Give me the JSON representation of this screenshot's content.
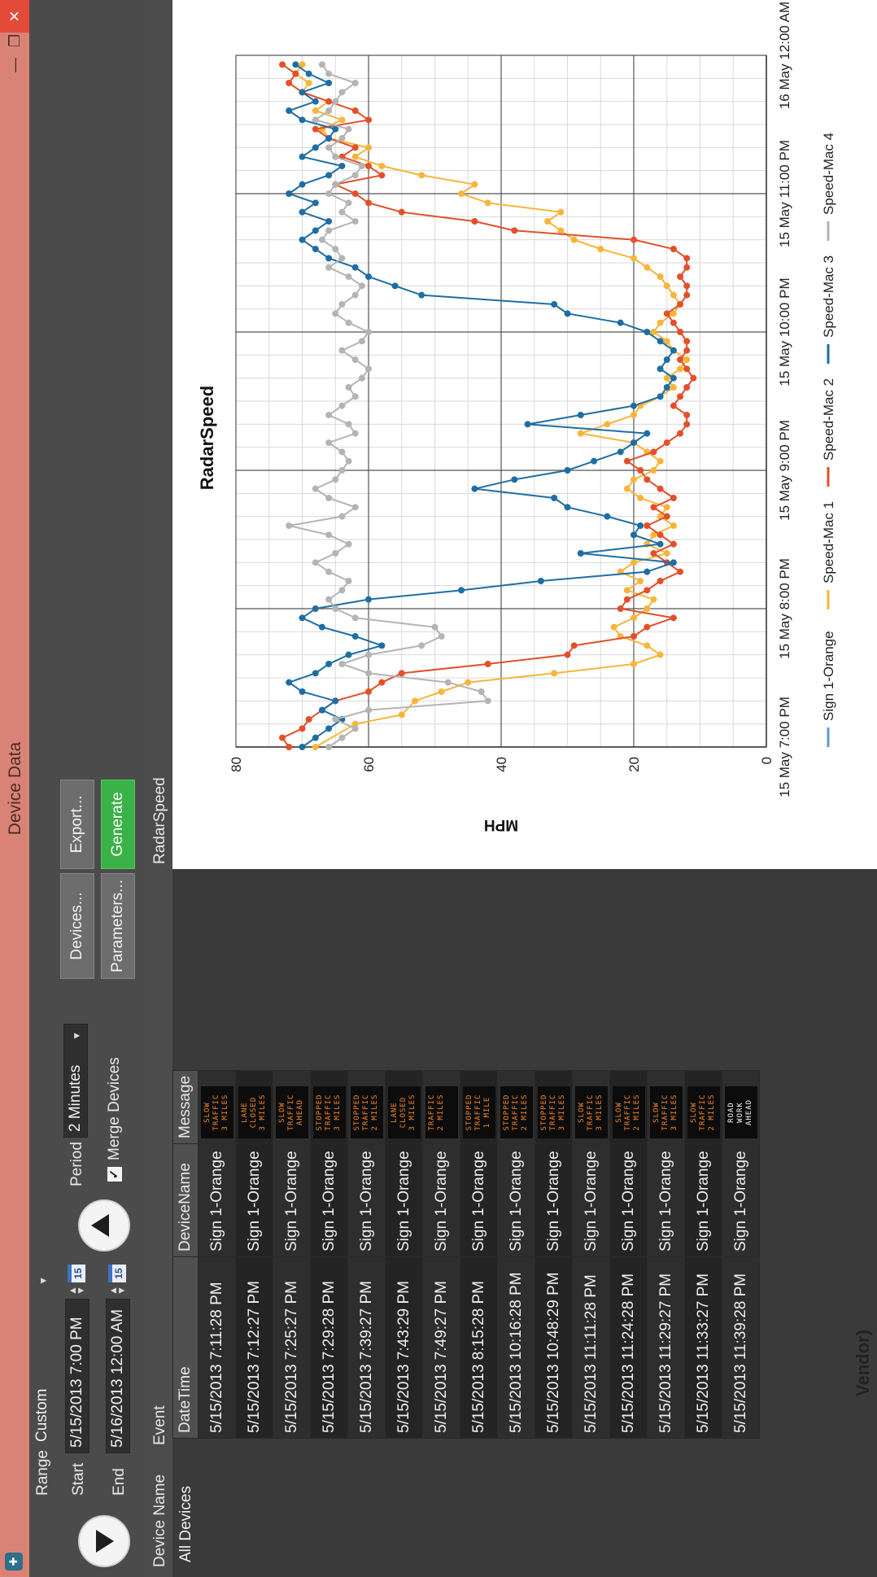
{
  "window": {
    "title": "Device Data",
    "vendor_tag": "Vendor)"
  },
  "toolbar": {
    "range_label": "Range",
    "range_value": "Custom",
    "start_label": "Start",
    "start_value": "5/15/2013 7:00 PM",
    "end_label": "End",
    "end_value": "5/16/2013 12:00 AM",
    "calendar_day": "15",
    "period_label": "Period",
    "period_value": "2 Minutes",
    "merge_label": "Merge Devices",
    "merge_checked": true,
    "devices_label": "Devices...",
    "parameters_label": "Parameters...",
    "export_label": "Export...",
    "generate_label": "Generate"
  },
  "device_panel": {
    "header": "Device Name",
    "items": [
      "All Devices"
    ]
  },
  "event_panel": {
    "tab": "Event",
    "columns": [
      "DateTime",
      "DeviceName",
      "Message"
    ],
    "rows": [
      {
        "datetime": "5/15/2013 7:11:28 PM",
        "device": "Sign 1-Orange",
        "message": "SLOW\nTRAFFIC\n3 MILES",
        "white": false
      },
      {
        "datetime": "5/15/2013 7:12:27 PM",
        "device": "Sign 1-Orange",
        "message": "LANE\nCLOSED\n3 MILES",
        "white": false
      },
      {
        "datetime": "5/15/2013 7:25:27 PM",
        "device": "Sign 1-Orange",
        "message": "SLOW\nTRAFFIC\nAHEAD",
        "white": false
      },
      {
        "datetime": "5/15/2013 7:29:28 PM",
        "device": "Sign 1-Orange",
        "message": "STOPPED\nTRAFFIC\n3 MILES",
        "white": false
      },
      {
        "datetime": "5/15/2013 7:39:27 PM",
        "device": "Sign 1-Orange",
        "message": "STOPPED\nTRAFFIC\n2 MILES",
        "white": false
      },
      {
        "datetime": "5/15/2013 7:43:29 PM",
        "device": "Sign 1-Orange",
        "message": "LANE\nCLOSED\n3 MILES",
        "white": false
      },
      {
        "datetime": "5/15/2013 7:49:27 PM",
        "device": "Sign 1-Orange",
        "message": "TRAFFIC\n2 MILES",
        "white": false
      },
      {
        "datetime": "5/15/2013 8:15:28 PM",
        "device": "Sign 1-Orange",
        "message": "STOPPED\nTRAFFIC\n1 MILE",
        "white": false
      },
      {
        "datetime": "5/15/2013 10:16:28 PM",
        "device": "Sign 1-Orange",
        "message": "STOPPED\nTRAFFIC\n2 MILES",
        "white": false
      },
      {
        "datetime": "5/15/2013 10:48:29 PM",
        "device": "Sign 1-Orange",
        "message": "STOPPED\nTRAFFIC\n3 MILES",
        "white": false
      },
      {
        "datetime": "5/15/2013 11:11:28 PM",
        "device": "Sign 1-Orange",
        "message": "SLOW\nTRAFFIC\n3 MILES",
        "white": false
      },
      {
        "datetime": "5/15/2013 11:24:28 PM",
        "device": "Sign 1-Orange",
        "message": "SLOW\nTRAFFIC\n2 MILES",
        "white": false
      },
      {
        "datetime": "5/15/2013 11:29:27 PM",
        "device": "Sign 1-Orange",
        "message": "SLOW\nTRAFFIC\n3 MILES",
        "white": false
      },
      {
        "datetime": "5/15/2013 11:33:27 PM",
        "device": "Sign 1-Orange",
        "message": "SLOW\nTRAFFIC\n2 MILES",
        "white": false
      },
      {
        "datetime": "5/15/2013 11:39:28 PM",
        "device": "Sign 1-Orange",
        "message": "ROAD\nWORK\nAHEAD",
        "white": true
      }
    ]
  },
  "chart_panel": {
    "tab": "RadarSpeed"
  },
  "chart_data": {
    "type": "line",
    "title": "RadarSpeed",
    "ylabel": "MPH",
    "xlabel": "",
    "ylim": [
      0,
      80
    ],
    "yticks": [
      0,
      20,
      40,
      60,
      80
    ],
    "xlim": [
      0,
      300
    ],
    "xticks": [
      0,
      60,
      120,
      180,
      240,
      300
    ],
    "xtick_labels": [
      "15 May 7:00 PM",
      "15 May 8:00 PM",
      "15 May 9:00 PM",
      "15 May 10:00 PM",
      "15 May 11:00 PM",
      "16 May 12:00 AM"
    ],
    "grid": true,
    "legend_position": "bottom",
    "series": [
      {
        "name": "Sign 1-Orange",
        "color": "#5b9bd5",
        "x": [],
        "y": []
      },
      {
        "name": "Speed-Mac 1",
        "color": "#f7b53b",
        "x": [
          0,
          10,
          14,
          20,
          24,
          28,
          32,
          36,
          40,
          44,
          48,
          52,
          56,
          60,
          64,
          68,
          72,
          76,
          80,
          84,
          88,
          92,
          96,
          100,
          104,
          108,
          112,
          116,
          120,
          124,
          128,
          132,
          136,
          140,
          144,
          148,
          152,
          156,
          160,
          164,
          168,
          172,
          176,
          180,
          184,
          188,
          192,
          196,
          200,
          204,
          208,
          212,
          216,
          220,
          224,
          228,
          232,
          236,
          240,
          244,
          248,
          252,
          256,
          260,
          264,
          268,
          272,
          276,
          280,
          284,
          288,
          292,
          296
        ],
        "y": [
          68,
          62,
          55,
          53,
          49,
          45,
          32,
          20,
          16,
          18,
          22,
          23,
          20,
          18,
          17,
          21,
          19,
          22,
          20,
          15,
          18,
          17,
          14,
          16,
          15,
          19,
          21,
          20,
          17,
          16,
          18,
          20,
          28,
          24,
          20,
          19,
          16,
          14,
          15,
          13,
          12,
          14,
          15,
          17,
          16,
          14,
          13,
          14,
          15,
          16,
          18,
          20,
          25,
          29,
          31,
          33,
          31,
          42,
          46,
          44,
          52,
          58,
          62,
          60,
          66,
          67,
          64,
          68,
          66,
          70,
          69,
          71,
          70
        ]
      },
      {
        "name": "Speed-Mac 2",
        "color": "#e2502b",
        "x": [
          0,
          4,
          8,
          12,
          16,
          20,
          24,
          28,
          32,
          36,
          40,
          44,
          48,
          52,
          56,
          60,
          64,
          68,
          72,
          76,
          80,
          84,
          88,
          92,
          96,
          100,
          104,
          108,
          112,
          116,
          120,
          124,
          128,
          132,
          136,
          140,
          144,
          148,
          152,
          156,
          160,
          164,
          168,
          172,
          176,
          180,
          184,
          188,
          192,
          196,
          200,
          204,
          208,
          212,
          216,
          220,
          224,
          228,
          232,
          236,
          240,
          244,
          248,
          252,
          256,
          260,
          264,
          268,
          272,
          276,
          280,
          284,
          288,
          292,
          296
        ],
        "y": [
          72,
          73,
          70,
          69,
          67,
          65,
          60,
          58,
          55,
          42,
          30,
          29,
          20,
          18,
          14,
          22,
          21,
          18,
          16,
          13,
          15,
          17,
          14,
          16,
          18,
          15,
          17,
          14,
          16,
          18,
          19,
          21,
          17,
          15,
          13,
          12,
          12,
          14,
          13,
          12,
          11,
          12,
          13,
          12,
          12,
          13,
          14,
          15,
          13,
          12,
          12,
          13,
          12,
          12,
          14,
          20,
          38,
          44,
          55,
          60,
          62,
          65,
          58,
          60,
          64,
          62,
          66,
          68,
          60,
          62,
          66,
          70,
          72,
          71,
          73
        ]
      },
      {
        "name": "Speed-Mac 3",
        "color": "#1f6ea3",
        "x": [
          0,
          4,
          8,
          12,
          16,
          20,
          24,
          28,
          32,
          36,
          40,
          44,
          48,
          52,
          56,
          60,
          64,
          68,
          72,
          76,
          80,
          84,
          88,
          92,
          96,
          100,
          104,
          108,
          112,
          116,
          120,
          124,
          128,
          132,
          136,
          140,
          144,
          148,
          152,
          156,
          160,
          164,
          168,
          172,
          176,
          180,
          184,
          188,
          192,
          196,
          200,
          204,
          208,
          212,
          216,
          220,
          224,
          228,
          232,
          236,
          240,
          244,
          248,
          252,
          256,
          260,
          264,
          268,
          272,
          276,
          280,
          284,
          288,
          292,
          296
        ],
        "y": [
          70,
          68,
          66,
          64,
          67,
          65,
          70,
          72,
          68,
          66,
          63,
          58,
          62,
          67,
          70,
          68,
          60,
          46,
          34,
          18,
          14,
          28,
          16,
          20,
          19,
          24,
          30,
          32,
          44,
          38,
          30,
          26,
          22,
          20,
          18,
          36,
          28,
          20,
          16,
          15,
          14,
          16,
          15,
          14,
          16,
          18,
          22,
          30,
          32,
          52,
          56,
          60,
          62,
          66,
          68,
          70,
          68,
          66,
          70,
          68,
          72,
          70,
          66,
          64,
          70,
          68,
          66,
          65,
          70,
          72,
          68,
          70,
          66,
          69,
          71
        ]
      },
      {
        "name": "Speed-Mac 4",
        "color": "#b4b4b4",
        "x": [
          0,
          4,
          8,
          12,
          16,
          20,
          24,
          28,
          32,
          36,
          40,
          44,
          48,
          52,
          56,
          60,
          64,
          68,
          72,
          76,
          80,
          84,
          88,
          92,
          96,
          100,
          104,
          108,
          112,
          116,
          120,
          124,
          128,
          132,
          136,
          140,
          144,
          148,
          152,
          156,
          160,
          164,
          168,
          172,
          176,
          180,
          184,
          188,
          192,
          196,
          200,
          204,
          208,
          212,
          216,
          220,
          224,
          228,
          232,
          236,
          240,
          244,
          248,
          252,
          256,
          260,
          264,
          268,
          272,
          276,
          280,
          284,
          288,
          292,
          296
        ],
        "y": [
          66,
          64,
          62,
          65,
          60,
          42,
          43,
          48,
          60,
          64,
          60,
          52,
          49,
          50,
          62,
          65,
          66,
          64,
          63,
          66,
          68,
          65,
          63,
          66,
          72,
          64,
          62,
          66,
          68,
          65,
          64,
          63,
          64,
          66,
          62,
          63,
          66,
          64,
          62,
          63,
          61,
          60,
          62,
          64,
          61,
          60,
          63,
          65,
          64,
          62,
          61,
          63,
          66,
          64,
          65,
          67,
          66,
          62,
          64,
          63,
          66,
          65,
          62,
          61,
          65,
          66,
          64,
          63,
          68,
          66,
          65,
          64,
          62,
          66,
          67
        ]
      }
    ]
  }
}
